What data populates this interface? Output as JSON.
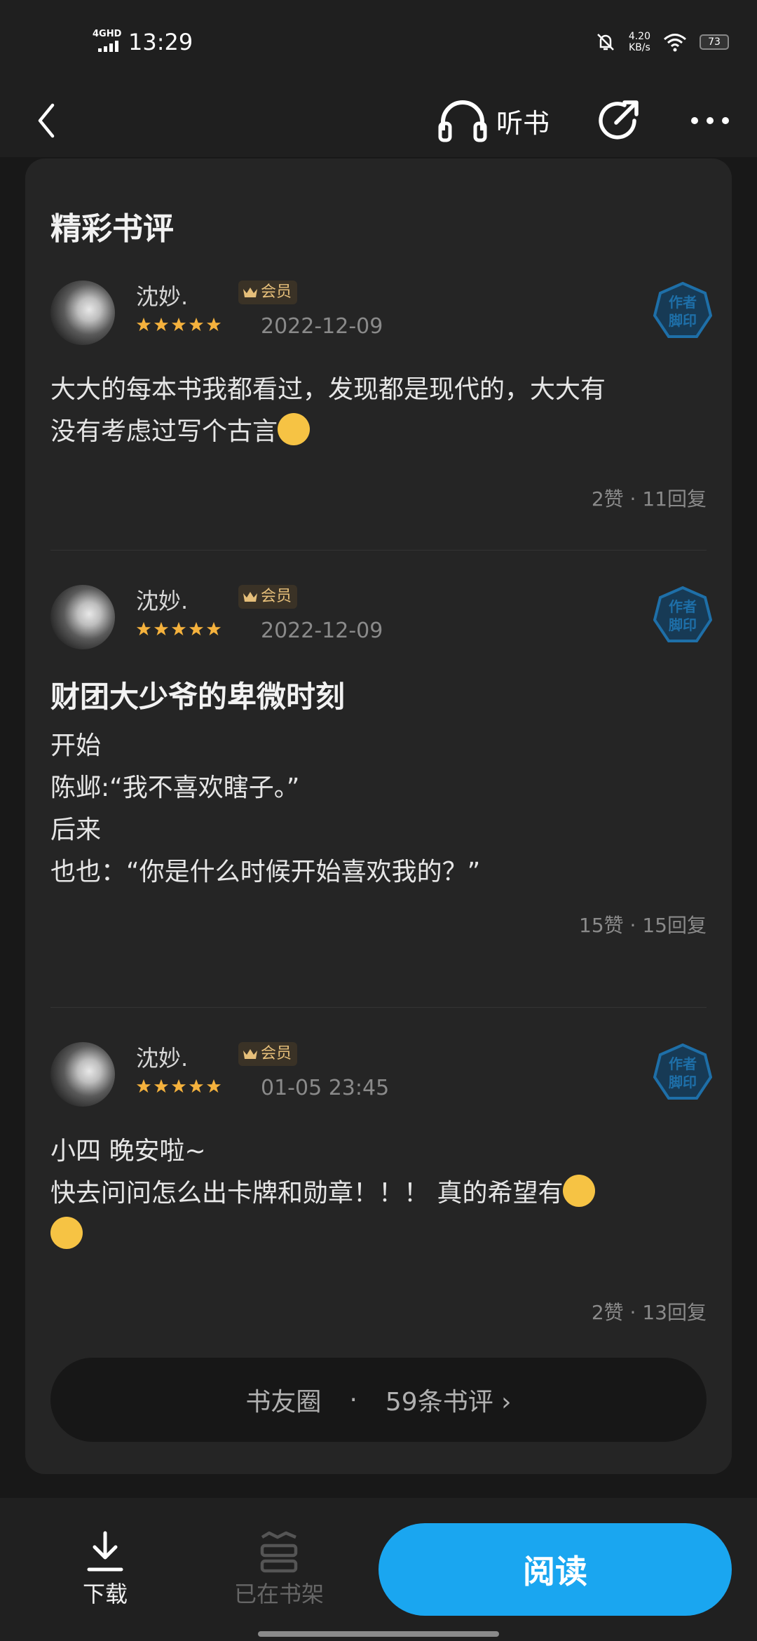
{
  "status_bar": {
    "network": "4GHD",
    "time": "13:29",
    "speed_value": "4.20",
    "speed_unit": "KB/s",
    "battery": "73"
  },
  "nav": {
    "listen_label": "听书"
  },
  "section": {
    "title": "精彩书评"
  },
  "reviews": [
    {
      "username": "沈妙.",
      "badge": "会员",
      "rating": 5,
      "date": "2022-12-09",
      "stamp_text": "作者脚印",
      "content": "大大的每本书我都看过，发现都是现代的，大大有\n没有考虑过写个古言",
      "stats": "2赞 · 11回复"
    },
    {
      "username": "沈妙.",
      "badge": "会员",
      "rating": 5,
      "date": "2022-12-09",
      "stamp_text": "作者脚印",
      "title": "财团大少爷的卑微时刻",
      "content": "开始\n陈邺:“我不喜欢瞎子。”\n后来\n也也：“你是什么时候开始喜欢我的？”",
      "stats": "15赞 · 15回复"
    },
    {
      "username": "沈妙.",
      "badge": "会员",
      "rating": 5,
      "date": "01-05  23:45",
      "stamp_text": "作者脚印",
      "content": "小四  晚安啦~\n快去问问怎么出卡牌和勋章！！！  真的希望有",
      "stats": "2赞 · 13回复"
    }
  ],
  "book_circle": {
    "label": "书友圈",
    "dot": "·",
    "count_label": "59条书评",
    "chevron": "›"
  },
  "bottom_bar": {
    "download_label": "下载",
    "shelf_label": "已在书架",
    "read_label": "阅读"
  },
  "colors": {
    "accent": "#1aa6f0",
    "vip_gold": "#e6bf7a",
    "star": "#f5b23d",
    "stamp": "#1e6fa8"
  }
}
